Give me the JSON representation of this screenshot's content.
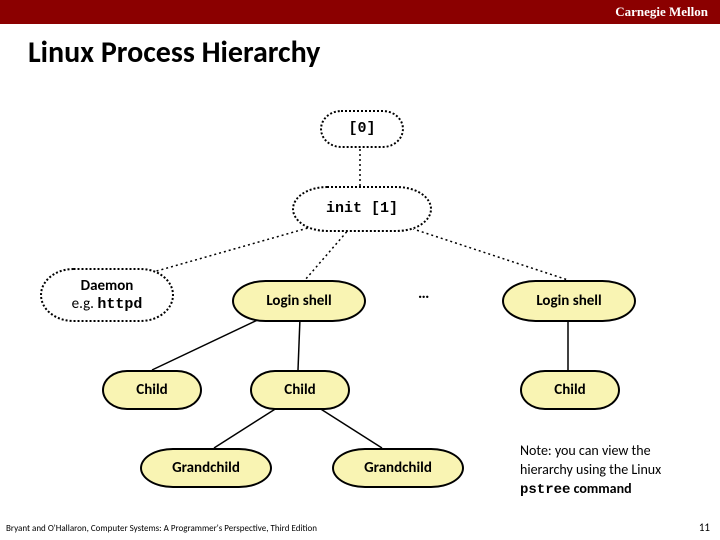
{
  "header": {
    "org": "Carnegie Mellon"
  },
  "title": "Linux Process Hierarchy",
  "nodes": {
    "root": "[0]",
    "init": "init [1]",
    "daemon_l1": "Daemon",
    "daemon_l2_prefix": "e.g. ",
    "daemon_l2_code": "httpd",
    "login1": "Login shell",
    "login2": "Login shell",
    "child1": "Child",
    "child2": "Child",
    "child3": "Child",
    "gc1": "Grandchild",
    "gc2": "Grandchild"
  },
  "ellipsis": "…",
  "note": {
    "l1": "Note: you can view the",
    "l2": "hierarchy using the Linux",
    "l3_code": "pstree",
    "l3_tail": " command"
  },
  "footer": "Bryant and O'Hallaron, Computer Systems: A Programmer's Perspective, Third Edition",
  "page": "11"
}
